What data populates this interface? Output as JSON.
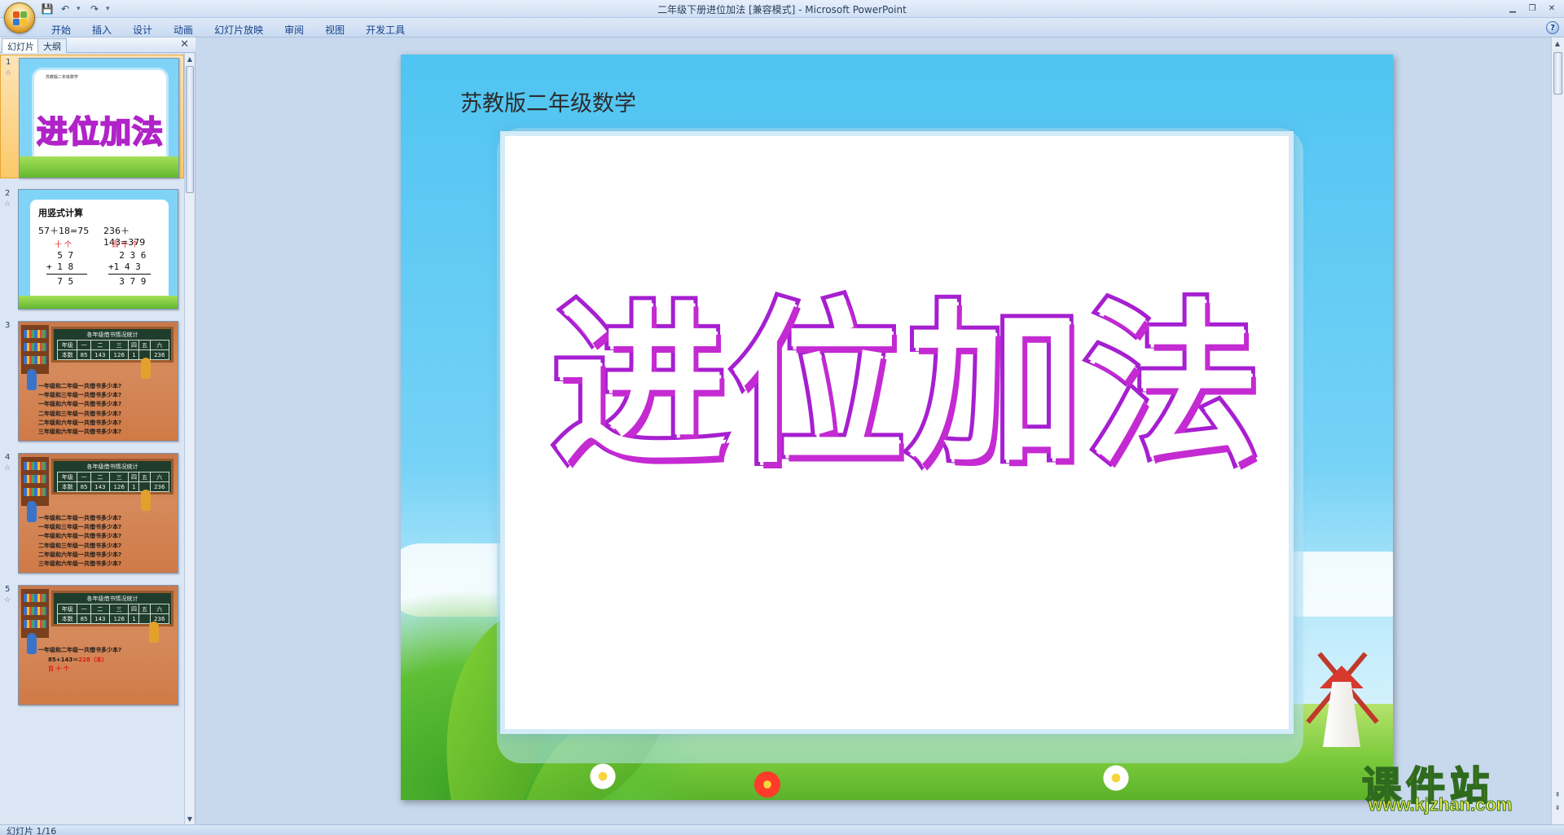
{
  "window": {
    "title": "二年级下册进位加法 [兼容模式] - Microsoft PowerPoint"
  },
  "ribbon": {
    "tabs": [
      "开始",
      "插入",
      "设计",
      "动画",
      "幻灯片放映",
      "审阅",
      "视图",
      "开发工具"
    ]
  },
  "left_pane": {
    "tab_slides": "幻灯片",
    "tab_outline": "大纲",
    "close": "✕"
  },
  "thumbnails": {
    "t1": {
      "num": "1",
      "small": "苏教版二年级数学",
      "title": "进位加法"
    },
    "t2": {
      "num": "2",
      "title": "用竖式计算",
      "eq1": "57＋18=75",
      "eq2": "236＋143=379",
      "red1": "十 个",
      "red2": "百 十 个",
      "col1": [
        "  5 7",
        "+ 1 8",
        "  7 5"
      ],
      "col2": [
        "  2 3 6",
        "+1 4 3",
        "  3 7 9"
      ]
    },
    "t3": {
      "num": "3",
      "board_title": "各年级借书情况统计",
      "header": [
        "年级",
        "一",
        "二",
        "三",
        "四",
        "五",
        "六"
      ],
      "row": [
        "本数",
        "85",
        "143",
        "126",
        "1",
        "",
        "236"
      ],
      "lines": [
        "一年级和二年级一共借书多少本?",
        "一年级和三年级一共借书多少本?",
        "一年级和六年级一共借书多少本?",
        "二年级和三年级一共借书多少本?",
        "二年级和六年级一共借书多少本?",
        "三年级和六年级一共借书多少本?"
      ]
    },
    "t4": {
      "num": "4"
    },
    "t5": {
      "num": "5",
      "line": "一年级和二年级一共借书多少本?",
      "answer": "85+143＝",
      "answer_red": "228（本）",
      "red_digits": "百 十 个"
    }
  },
  "slide": {
    "subtitle": "苏教版二年级数学",
    "title": "进位加法"
  },
  "status": {
    "slide_info": "幻灯片 1/16"
  },
  "watermark": {
    "cn": "课件站",
    "url": "www.kjzhan.com"
  },
  "colors": {
    "title_stroke": "#a61fd0",
    "sky": "#4fc4f2",
    "grass": "#79c93a",
    "selected_thumb": "#fbc969"
  }
}
